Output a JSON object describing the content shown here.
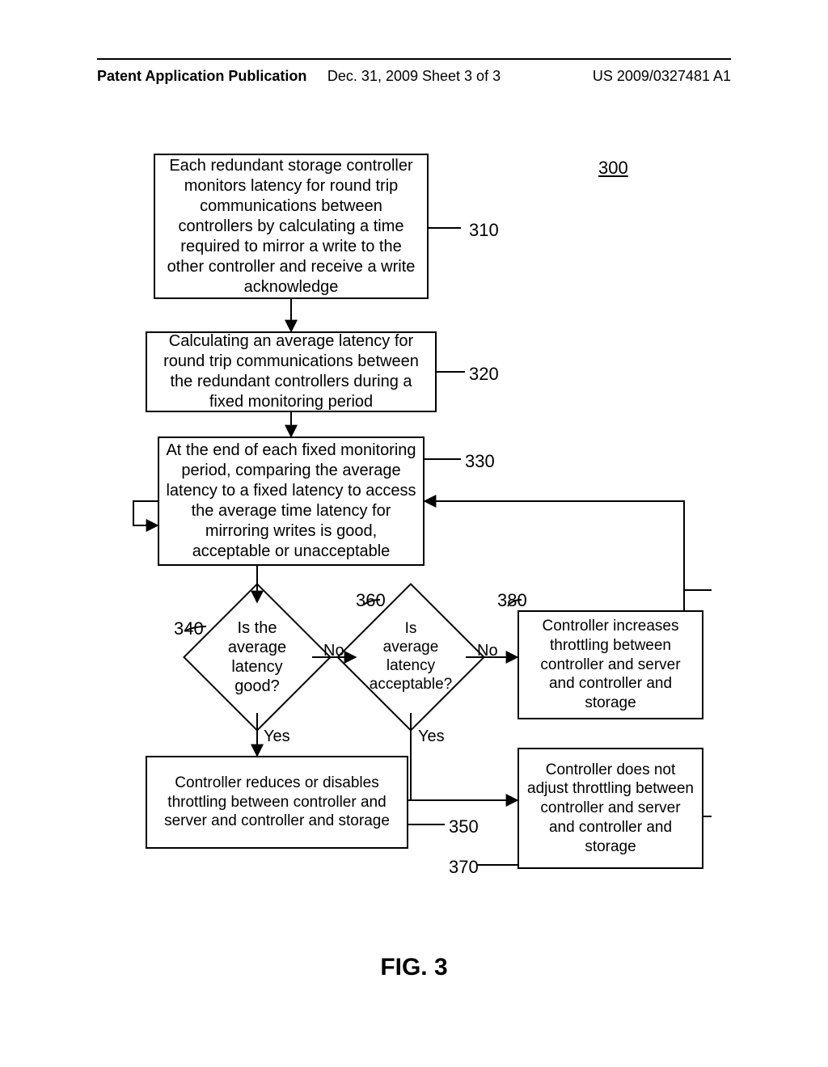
{
  "header": {
    "left": "Patent Application Publication",
    "center": "Dec. 31, 2009   Sheet 3 of 3",
    "right": "US 2009/0327481 A1"
  },
  "figure": {
    "title_ref": "300",
    "caption": "FIG. 3",
    "boxes": {
      "b310": "Each redundant storage controller monitors latency for round trip communications between controllers by calculating a time required to mirror a write to the other controller and receive a write acknowledge",
      "b320": "Calculating an average latency for round trip communications between the redundant controllers during a fixed monitoring period",
      "b330": "At the end of each fixed monitoring period, comparing the average latency to a fixed latency to access the average time latency for mirroring writes is good, acceptable or unacceptable",
      "b350": "Controller reduces or disables throttling between controller and server and controller and storage",
      "b370": "Controller does not adjust throttling between controller and server and controller and storage",
      "b380": "Controller increases throttling between controller and server and controller and storage"
    },
    "decisions": {
      "d340": "Is the\naverage\nlatency\ngood?",
      "d360": "Is\naverage latency\nacceptable?"
    },
    "edge_labels": {
      "d340_no": "No",
      "d340_yes": "Yes",
      "d360_no": "No",
      "d360_yes": "Yes"
    },
    "refs": {
      "r310": "310",
      "r320": "320",
      "r330": "330",
      "r340": "340",
      "r350": "350",
      "r360": "360",
      "r370": "370",
      "r380": "380"
    }
  }
}
